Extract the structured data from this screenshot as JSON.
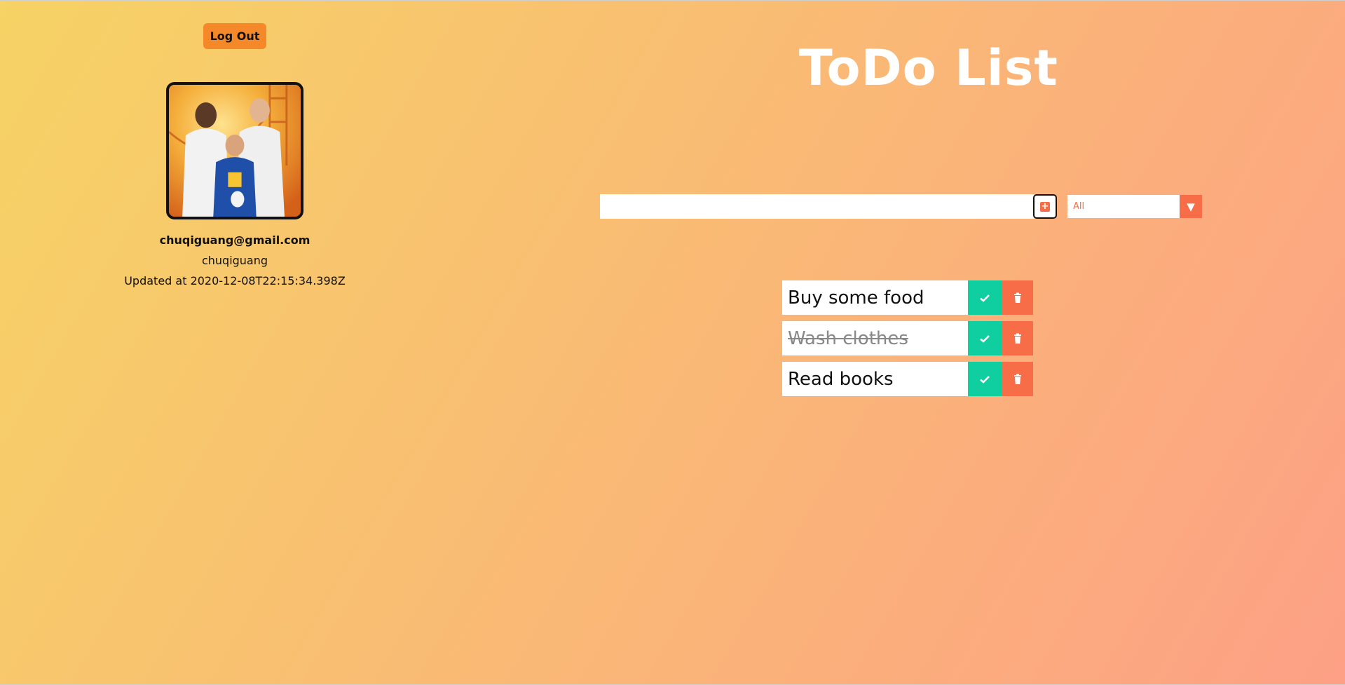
{
  "profile": {
    "logout_label": "Log Out",
    "email": "chuqiguang@gmail.com",
    "username": "chuqiguang",
    "updated_text": "Updated at 2020-12-08T22:15:34.398Z",
    "avatar_icon": "avatar-image"
  },
  "main": {
    "title": "ToDo List",
    "input": {
      "value": "",
      "placeholder": ""
    },
    "add_icon": "plus-square-icon",
    "filter": {
      "selected": "All",
      "arrow": "▼"
    },
    "todos": [
      {
        "text": "Buy some food",
        "completed": false
      },
      {
        "text": "Wash clothes",
        "completed": true
      },
      {
        "text": "Read books",
        "completed": false
      }
    ]
  },
  "colors": {
    "gradient_start": "#f6d365",
    "gradient_end": "#fda085",
    "accent_orange": "#f76d47",
    "complete_green": "#0fcea0",
    "logout_orange": "#f5892a"
  }
}
